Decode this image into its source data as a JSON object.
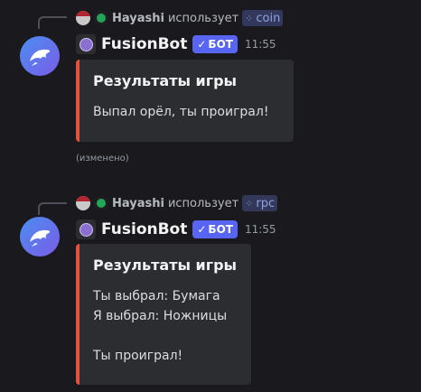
{
  "messages": [
    {
      "reply": {
        "user": "Hayashi",
        "action": "использует",
        "command": "coin",
        "command_icon": "slash-command-icon"
      },
      "author": {
        "name": "FusionBot",
        "tag": "БОТ",
        "time": "11:55"
      },
      "embed": {
        "title": "Результаты игры",
        "description": "Выпал орёл, ты проиграл!",
        "color": "#e0533d"
      },
      "edited": "(изменено)"
    },
    {
      "reply": {
        "user": "Hayashi",
        "action": "использует",
        "command": "rpc",
        "command_icon": "slash-command-icon"
      },
      "author": {
        "name": "FusionBot",
        "tag": "БОТ",
        "time": "11:55"
      },
      "embed": {
        "title": "Результаты игры",
        "description": "Ты выбрал: Бумага\nЯ выбрал: Ножницы\n\nТы проиграл!",
        "color": "#e0533d"
      }
    }
  ],
  "colors": {
    "background": "#1a1a1e",
    "embed_bg": "#2b2d31",
    "embed_accent": "#e0533d",
    "bot_tag": "#5865f2",
    "command_chip": "#33385a",
    "command_text": "#8ea1e1"
  }
}
